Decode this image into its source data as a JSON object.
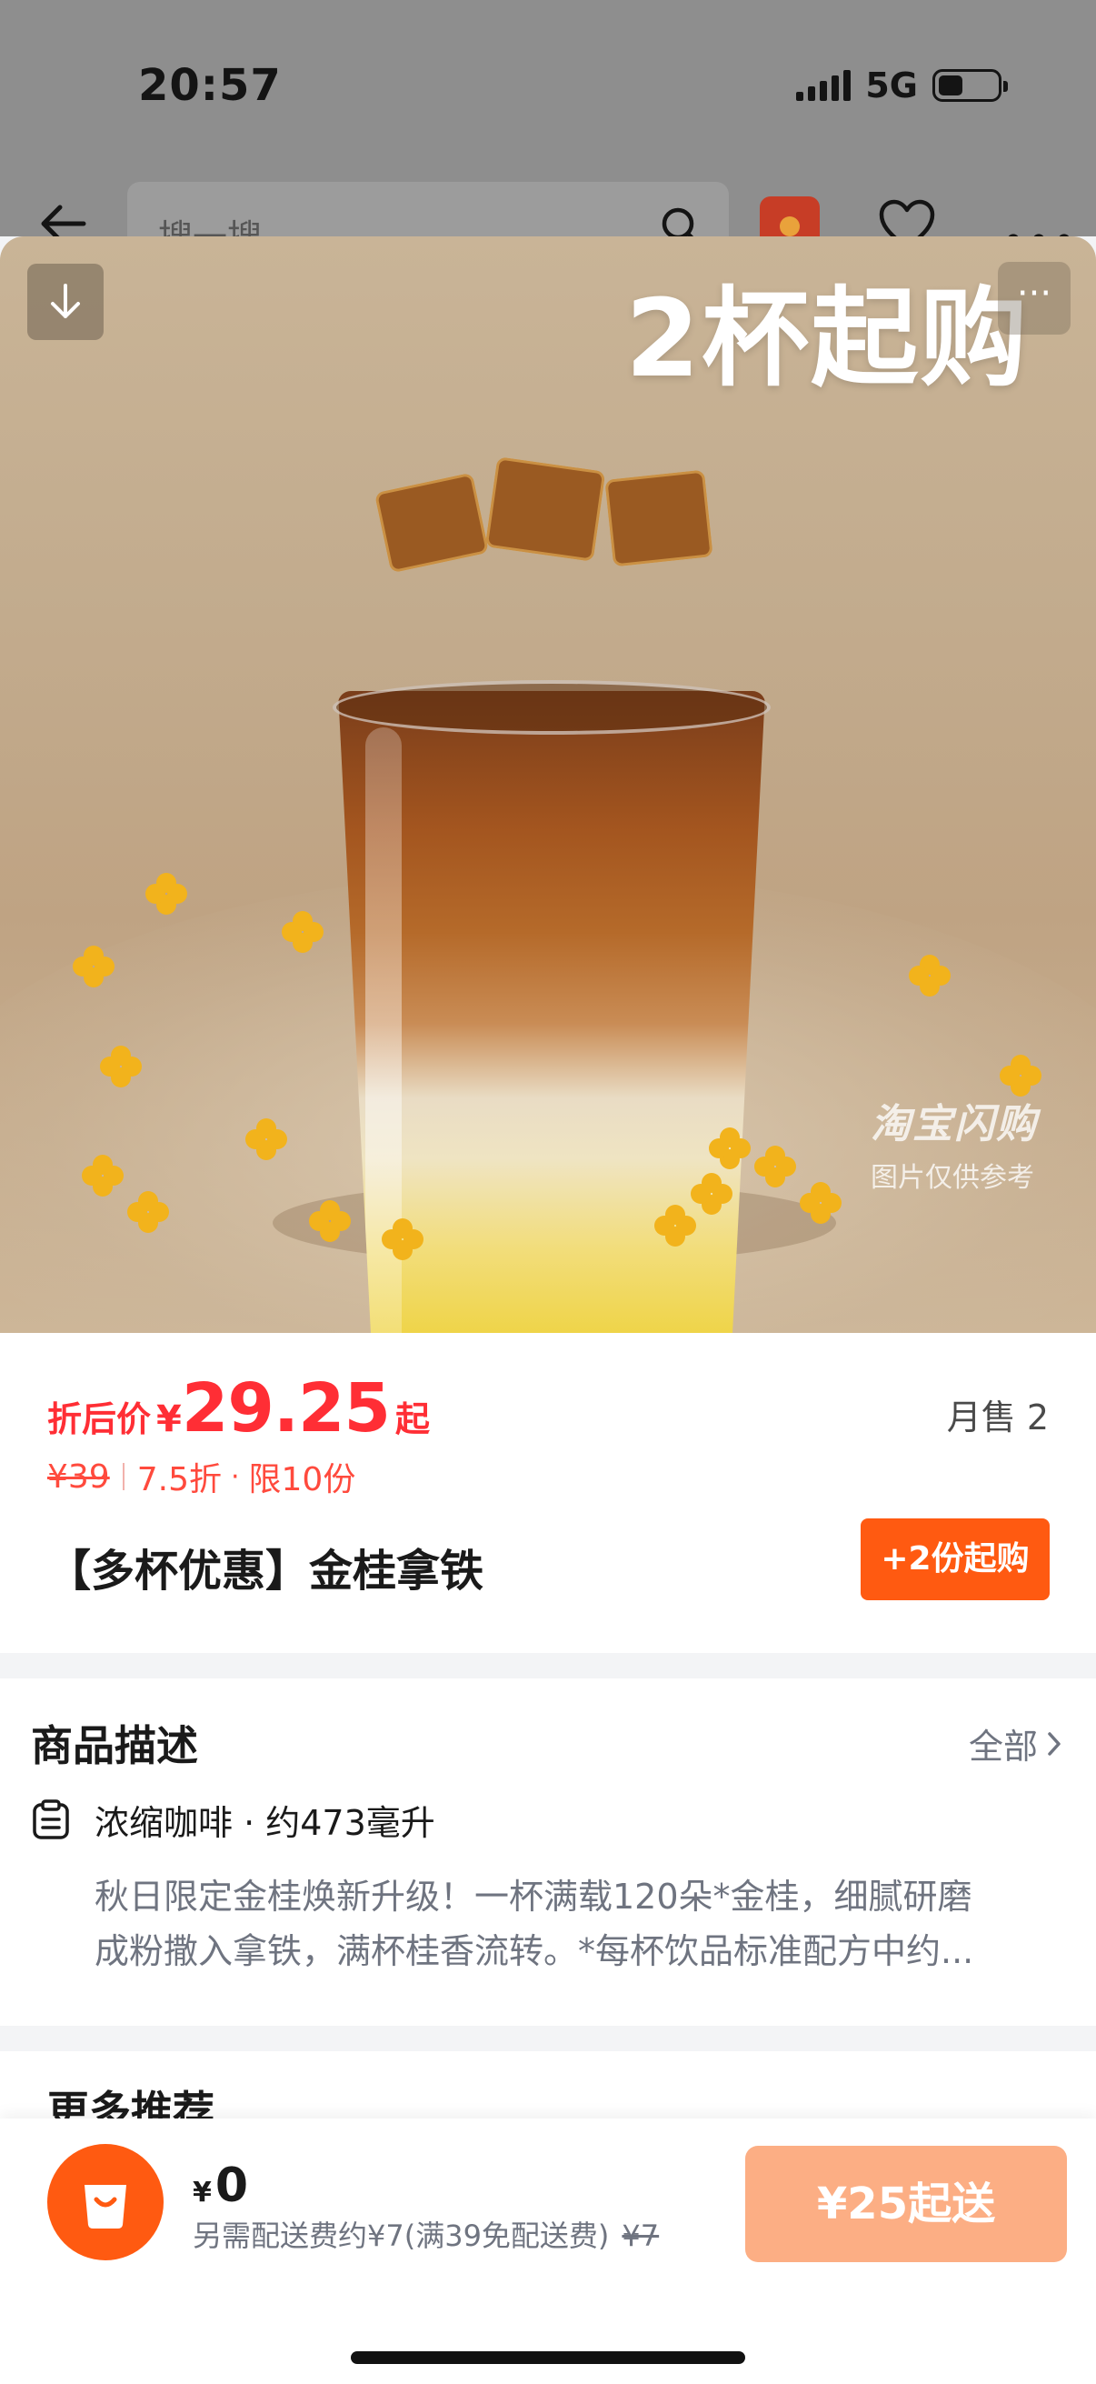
{
  "status_bar": {
    "time": "20:57",
    "network": "5G"
  },
  "background_page": {
    "search_placeholder": "搜一搜"
  },
  "hero": {
    "banner_text": "2杯起购",
    "more_glyph": "···",
    "watermark_line1": "淘宝闪购",
    "watermark_line2": "图片仅供参考"
  },
  "price": {
    "label": "折后价",
    "currency": "¥",
    "amount": "29.25",
    "suffix": "起",
    "original": "¥39",
    "discount": "7.5折",
    "limit": "限10份",
    "monthly_sales": "月售 2"
  },
  "product": {
    "title": "【多杯优惠】金桂拿铁",
    "buy_button": "+2份起购"
  },
  "description": {
    "heading": "商品描述",
    "all_link": "全部",
    "spec": "浓缩咖啡 · 约473毫升",
    "line1": "秋日限定金桂焕新升级！一杯满载120朵*金桂，细腻研磨",
    "line2": "成粉撒入拿铁，满杯桂香流转。*每杯饮品标准配方中约..."
  },
  "recommend": {
    "heading": "更多推荐"
  },
  "bottom_bar": {
    "currency": "¥",
    "total": "0",
    "delivery_note": "另需配送费约¥7(满39免配送费)",
    "delivery_original": "¥7",
    "checkout_label": "¥25起送"
  },
  "colors": {
    "price_red": "#ff2e35",
    "accent_orange": "#ff5a11",
    "checkout_disabled": "#fcae84",
    "muted_text": "#6f7480"
  },
  "icons": [
    "back-arrow-icon",
    "search-icon",
    "heart-icon",
    "more-icon",
    "download-icon",
    "document-icon",
    "chevron-right-icon",
    "shopping-bag-icon"
  ]
}
